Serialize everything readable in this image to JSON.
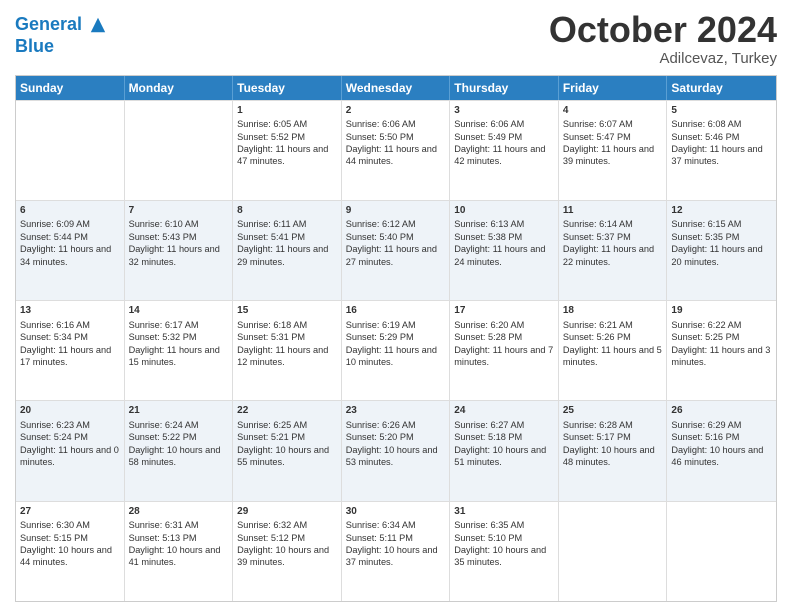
{
  "header": {
    "logo_line1": "General",
    "logo_line2": "Blue",
    "month": "October 2024",
    "location": "Adilcevaz, Turkey"
  },
  "weekdays": [
    "Sunday",
    "Monday",
    "Tuesday",
    "Wednesday",
    "Thursday",
    "Friday",
    "Saturday"
  ],
  "rows": [
    [
      {
        "day": "",
        "sunrise": "",
        "sunset": "",
        "daylight": ""
      },
      {
        "day": "",
        "sunrise": "",
        "sunset": "",
        "daylight": ""
      },
      {
        "day": "1",
        "sunrise": "Sunrise: 6:05 AM",
        "sunset": "Sunset: 5:52 PM",
        "daylight": "Daylight: 11 hours and 47 minutes."
      },
      {
        "day": "2",
        "sunrise": "Sunrise: 6:06 AM",
        "sunset": "Sunset: 5:50 PM",
        "daylight": "Daylight: 11 hours and 44 minutes."
      },
      {
        "day": "3",
        "sunrise": "Sunrise: 6:06 AM",
        "sunset": "Sunset: 5:49 PM",
        "daylight": "Daylight: 11 hours and 42 minutes."
      },
      {
        "day": "4",
        "sunrise": "Sunrise: 6:07 AM",
        "sunset": "Sunset: 5:47 PM",
        "daylight": "Daylight: 11 hours and 39 minutes."
      },
      {
        "day": "5",
        "sunrise": "Sunrise: 6:08 AM",
        "sunset": "Sunset: 5:46 PM",
        "daylight": "Daylight: 11 hours and 37 minutes."
      }
    ],
    [
      {
        "day": "6",
        "sunrise": "Sunrise: 6:09 AM",
        "sunset": "Sunset: 5:44 PM",
        "daylight": "Daylight: 11 hours and 34 minutes."
      },
      {
        "day": "7",
        "sunrise": "Sunrise: 6:10 AM",
        "sunset": "Sunset: 5:43 PM",
        "daylight": "Daylight: 11 hours and 32 minutes."
      },
      {
        "day": "8",
        "sunrise": "Sunrise: 6:11 AM",
        "sunset": "Sunset: 5:41 PM",
        "daylight": "Daylight: 11 hours and 29 minutes."
      },
      {
        "day": "9",
        "sunrise": "Sunrise: 6:12 AM",
        "sunset": "Sunset: 5:40 PM",
        "daylight": "Daylight: 11 hours and 27 minutes."
      },
      {
        "day": "10",
        "sunrise": "Sunrise: 6:13 AM",
        "sunset": "Sunset: 5:38 PM",
        "daylight": "Daylight: 11 hours and 24 minutes."
      },
      {
        "day": "11",
        "sunrise": "Sunrise: 6:14 AM",
        "sunset": "Sunset: 5:37 PM",
        "daylight": "Daylight: 11 hours and 22 minutes."
      },
      {
        "day": "12",
        "sunrise": "Sunrise: 6:15 AM",
        "sunset": "Sunset: 5:35 PM",
        "daylight": "Daylight: 11 hours and 20 minutes."
      }
    ],
    [
      {
        "day": "13",
        "sunrise": "Sunrise: 6:16 AM",
        "sunset": "Sunset: 5:34 PM",
        "daylight": "Daylight: 11 hours and 17 minutes."
      },
      {
        "day": "14",
        "sunrise": "Sunrise: 6:17 AM",
        "sunset": "Sunset: 5:32 PM",
        "daylight": "Daylight: 11 hours and 15 minutes."
      },
      {
        "day": "15",
        "sunrise": "Sunrise: 6:18 AM",
        "sunset": "Sunset: 5:31 PM",
        "daylight": "Daylight: 11 hours and 12 minutes."
      },
      {
        "day": "16",
        "sunrise": "Sunrise: 6:19 AM",
        "sunset": "Sunset: 5:29 PM",
        "daylight": "Daylight: 11 hours and 10 minutes."
      },
      {
        "day": "17",
        "sunrise": "Sunrise: 6:20 AM",
        "sunset": "Sunset: 5:28 PM",
        "daylight": "Daylight: 11 hours and 7 minutes."
      },
      {
        "day": "18",
        "sunrise": "Sunrise: 6:21 AM",
        "sunset": "Sunset: 5:26 PM",
        "daylight": "Daylight: 11 hours and 5 minutes."
      },
      {
        "day": "19",
        "sunrise": "Sunrise: 6:22 AM",
        "sunset": "Sunset: 5:25 PM",
        "daylight": "Daylight: 11 hours and 3 minutes."
      }
    ],
    [
      {
        "day": "20",
        "sunrise": "Sunrise: 6:23 AM",
        "sunset": "Sunset: 5:24 PM",
        "daylight": "Daylight: 11 hours and 0 minutes."
      },
      {
        "day": "21",
        "sunrise": "Sunrise: 6:24 AM",
        "sunset": "Sunset: 5:22 PM",
        "daylight": "Daylight: 10 hours and 58 minutes."
      },
      {
        "day": "22",
        "sunrise": "Sunrise: 6:25 AM",
        "sunset": "Sunset: 5:21 PM",
        "daylight": "Daylight: 10 hours and 55 minutes."
      },
      {
        "day": "23",
        "sunrise": "Sunrise: 6:26 AM",
        "sunset": "Sunset: 5:20 PM",
        "daylight": "Daylight: 10 hours and 53 minutes."
      },
      {
        "day": "24",
        "sunrise": "Sunrise: 6:27 AM",
        "sunset": "Sunset: 5:18 PM",
        "daylight": "Daylight: 10 hours and 51 minutes."
      },
      {
        "day": "25",
        "sunrise": "Sunrise: 6:28 AM",
        "sunset": "Sunset: 5:17 PM",
        "daylight": "Daylight: 10 hours and 48 minutes."
      },
      {
        "day": "26",
        "sunrise": "Sunrise: 6:29 AM",
        "sunset": "Sunset: 5:16 PM",
        "daylight": "Daylight: 10 hours and 46 minutes."
      }
    ],
    [
      {
        "day": "27",
        "sunrise": "Sunrise: 6:30 AM",
        "sunset": "Sunset: 5:15 PM",
        "daylight": "Daylight: 10 hours and 44 minutes."
      },
      {
        "day": "28",
        "sunrise": "Sunrise: 6:31 AM",
        "sunset": "Sunset: 5:13 PM",
        "daylight": "Daylight: 10 hours and 41 minutes."
      },
      {
        "day": "29",
        "sunrise": "Sunrise: 6:32 AM",
        "sunset": "Sunset: 5:12 PM",
        "daylight": "Daylight: 10 hours and 39 minutes."
      },
      {
        "day": "30",
        "sunrise": "Sunrise: 6:34 AM",
        "sunset": "Sunset: 5:11 PM",
        "daylight": "Daylight: 10 hours and 37 minutes."
      },
      {
        "day": "31",
        "sunrise": "Sunrise: 6:35 AM",
        "sunset": "Sunset: 5:10 PM",
        "daylight": "Daylight: 10 hours and 35 minutes."
      },
      {
        "day": "",
        "sunrise": "",
        "sunset": "",
        "daylight": ""
      },
      {
        "day": "",
        "sunrise": "",
        "sunset": "",
        "daylight": ""
      }
    ]
  ]
}
